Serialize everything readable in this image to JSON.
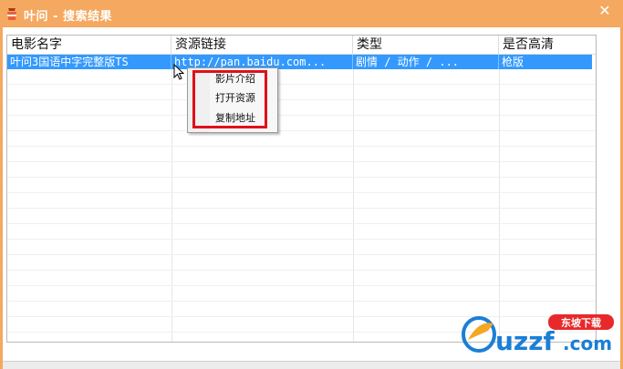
{
  "window": {
    "title": "叶问 - 搜索结果",
    "close_symbol": "✕"
  },
  "table": {
    "columns": [
      "电影名字",
      "资源链接",
      "类型",
      "是否高清"
    ],
    "rows": [
      {
        "name": "叶问3国语中字完整版TS",
        "link": "http://pan.baidu.com...",
        "genre": "剧情 / 动作 / ...",
        "quality": "枪版"
      }
    ]
  },
  "context_menu": {
    "items": [
      "影片介绍",
      "打开资源",
      "复制地址"
    ]
  },
  "watermark": {
    "text_main": "uzzf",
    "text_suffix": ".com",
    "badge_text": "东坡下载"
  },
  "colors": {
    "titlebar": "#f4a860",
    "selection": "#3399ff",
    "highlight_box": "#e0101a",
    "watermark_blue": "#1a7fd6",
    "watermark_badge": "#e8292b"
  },
  "icons": {
    "app": "app-icon",
    "close": "close-icon",
    "cursor": "mouse-pointer-icon",
    "logo": "uzzf-logo"
  }
}
